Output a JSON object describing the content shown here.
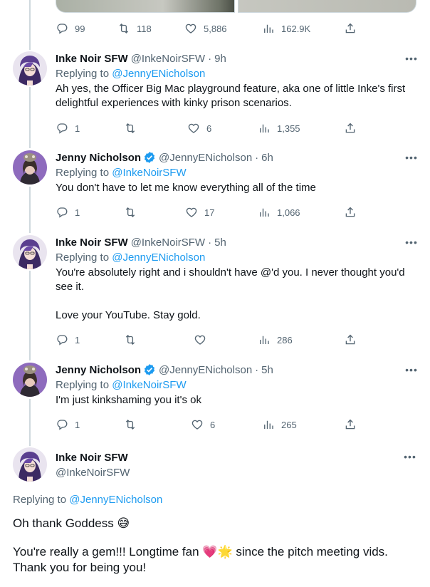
{
  "top_tweet": {
    "replies": "99",
    "retweets": "118",
    "likes": "5,886",
    "views": "162.9K"
  },
  "replies": [
    {
      "name": "Inke Noir SFW",
      "handle": "@InkeNoirSFW",
      "time": "9h",
      "replying_label": "Replying to ",
      "replying_to": "@JennyENicholson",
      "paragraphs": [
        "Ah yes, the Officer Big Mac playground feature, aka one of little Inke's first delightful experiences with kinky prison scenarios."
      ],
      "replies": "1",
      "retweets": "",
      "likes": "6",
      "views": "1,355"
    },
    {
      "name": "Jenny Nicholson",
      "handle": "@JennyENicholson",
      "time": "6h",
      "replying_label": "Replying to ",
      "replying_to": "@InkeNoirSFW",
      "paragraphs": [
        "You don't have to let me know everything all of the time"
      ],
      "replies": "1",
      "retweets": "",
      "likes": "17",
      "views": "1,066"
    },
    {
      "name": "Inke Noir SFW",
      "handle": "@InkeNoirSFW",
      "time": "5h",
      "replying_label": "Replying to ",
      "replying_to": "@JennyENicholson",
      "paragraphs": [
        "You're absolutely right and i shouldn't have @'d you. I never thought you'd see it.",
        "Love your YouTube. Stay gold."
      ],
      "replies": "1",
      "retweets": "",
      "likes": "",
      "views": "286"
    },
    {
      "name": "Jenny Nicholson",
      "handle": "@JennyENicholson",
      "time": "5h",
      "replying_label": "Replying to ",
      "replying_to": "@InkeNoirSFW",
      "paragraphs": [
        "I'm just kinkshaming you it's ok"
      ],
      "replies": "1",
      "retweets": "",
      "likes": "6",
      "views": "265"
    }
  ],
  "main_tweet": {
    "name": "Inke Noir SFW",
    "handle": "@InkeNoirSFW",
    "replying_label": "Replying to ",
    "replying_to": "@JennyENicholson",
    "line1": "Oh thank Goddess ",
    "line1_emoji": "😅",
    "line2_a": "You're really a gem!!! Longtime fan ",
    "line2_emoji": "💗🌟",
    "line2_b": " since the pitch meeting vids.",
    "line3": "Thank you for being you!"
  },
  "icons": {
    "reply": "reply-icon",
    "retweet": "retweet-icon",
    "like": "heart-icon",
    "views": "views-icon",
    "share": "share-icon",
    "more": "more-icon",
    "verified": "verified-badge-icon"
  },
  "colors": {
    "link": "#1d9bf0",
    "secondary": "#536471",
    "verified": "#1d9bf0"
  }
}
